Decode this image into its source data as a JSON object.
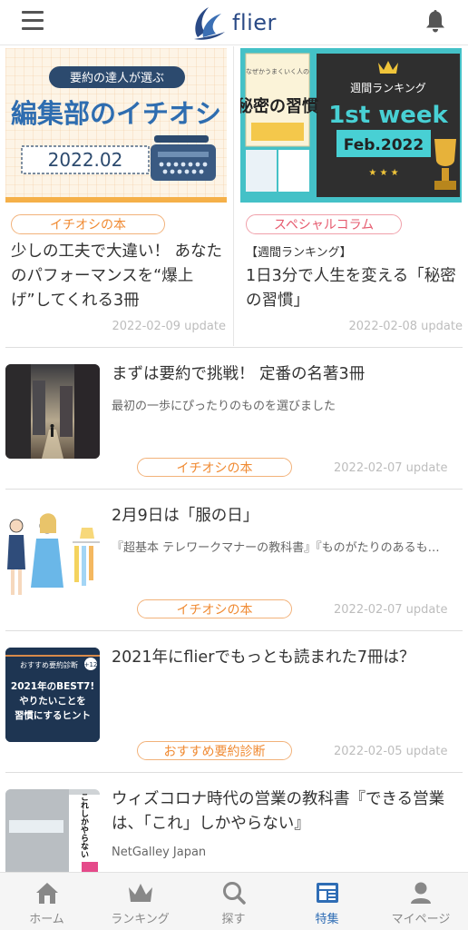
{
  "header": {
    "logo_text": "flier"
  },
  "featured": [
    {
      "banner_badge": "要約の達人が選ぶ",
      "banner_title": "編集部のイチオシ",
      "banner_date": "2022.02",
      "tag": "イチオシの本",
      "title_lines": [
        "少しの工夫で大違い！ あなた",
        "のパフォーマンスを“爆上",
        "げ”してくれる3冊"
      ],
      "date": "2022-02-09 update"
    },
    {
      "banner_book_title": "秘密の習慣",
      "banner_book_sub": "なぜかうまくいく人の",
      "banner_heading": "週間ランキング",
      "banner_week": "1st week",
      "banner_month": "Feb.2022",
      "tag": "スペシャルコラム",
      "subtitle": "【週間ランキング】",
      "title_lines": [
        "1日3分で人生を変える「秘密",
        "の習慣」"
      ],
      "date": "2022-02-08 update"
    }
  ],
  "items": [
    {
      "title": "まずは要約で挑戦！ 定番の名著3冊",
      "desc": "最初の一歩にぴったりのものを選びました",
      "tag": "イチオシの本",
      "date": "2022-02-07 update"
    },
    {
      "title": "2月9日は「服の日」",
      "desc": "『超基本 テレワークマナーの教科書』『ものがたりのあるも…",
      "tag": "イチオシの本",
      "date": "2022-02-07 update"
    },
    {
      "title": "2021年にflierでもっとも読まれた7冊は？",
      "thumb_header": "おすすめ要約診断",
      "thumb_lines": [
        "2021年のBEST7!",
        "やりたいことを",
        "習慣にするヒント"
      ],
      "tag": "おすすめ要約診断",
      "date": "2022-02-05 update"
    },
    {
      "title_lines": [
        "ウィズコロナ時代の営業の教科書『できる営業",
        "は、「これ」しかやらない』"
      ],
      "desc": "NetGalley Japan",
      "thumb_text": "これしかやらない"
    }
  ],
  "nav": [
    {
      "label": "ホーム",
      "icon": "home-icon"
    },
    {
      "label": "ランキング",
      "icon": "crown-icon"
    },
    {
      "label": "探す",
      "icon": "search-icon"
    },
    {
      "label": "特集",
      "icon": "feature-icon",
      "active": true
    },
    {
      "label": "マイページ",
      "icon": "person-icon"
    }
  ],
  "colors": {
    "accent_orange": "#f08a32",
    "accent_pink": "#e65a6e",
    "brand_blue": "#2a4a86",
    "active_tab": "#2f6db5"
  }
}
